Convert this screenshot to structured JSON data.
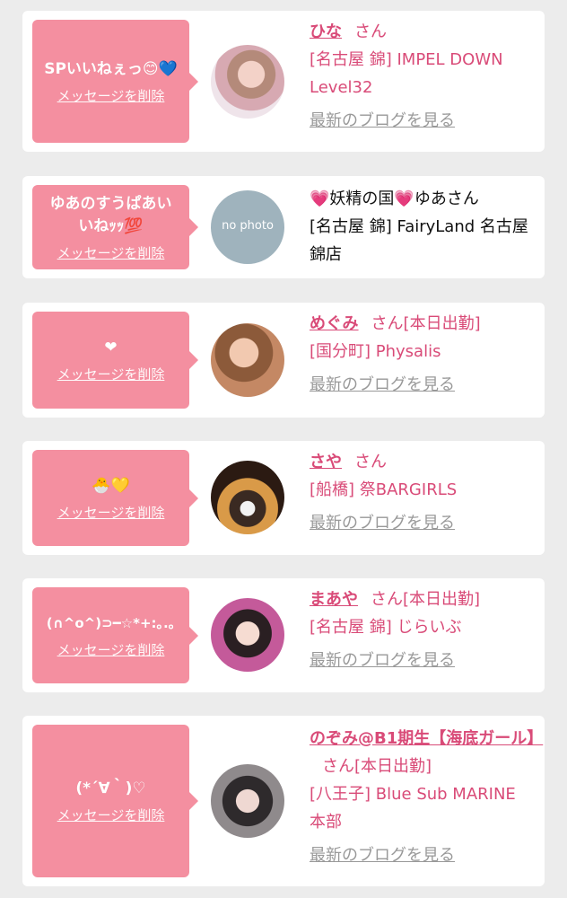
{
  "delete_label": "メッセージを削除",
  "blog_label": "最新のブログを見る",
  "colors": {
    "bubble": "#f48fa0",
    "name": "#d94b78",
    "link_gray": "#999999",
    "background": "#ececec"
  },
  "entries": [
    {
      "message": "SPいいねぇっ😊💙",
      "name": "ひな",
      "suffix": "さん",
      "badge": "",
      "shop": "[名古屋 錦] IMPEL DOWN Level32",
      "has_blog": true
    },
    {
      "message": "ゆあのすうぱあいいねｯｯ💯",
      "name": "💗妖精の国💗ゆあさん",
      "suffix": "",
      "badge": "",
      "shop": "[名古屋 錦] FairyLand 名古屋錦店",
      "avatar_text": "no photo",
      "has_blog": false
    },
    {
      "message": "❤",
      "name": "めぐみ",
      "suffix": "さん",
      "badge": "[本日出勤]",
      "shop": "[国分町] Physalis",
      "has_blog": true
    },
    {
      "message": "🐣💛",
      "name": "さや",
      "suffix": "さん",
      "badge": "",
      "shop": "[船橋] 祭BARGIRLS",
      "has_blog": true
    },
    {
      "message": "(∩^o^)⊃━☆*+:｡.｡",
      "name": "まあや",
      "suffix": "さん",
      "badge": "[本日出勤]",
      "shop": "[名古屋 錦] じらいぶ",
      "has_blog": true
    },
    {
      "message": "(*´∀｀)♡",
      "name": "のぞみ@B1期生【海底ガール】",
      "suffix": "さん",
      "badge": "[本日出勤]",
      "shop": "[八王子] Blue Sub MARINE 本部",
      "has_blog": true
    }
  ]
}
